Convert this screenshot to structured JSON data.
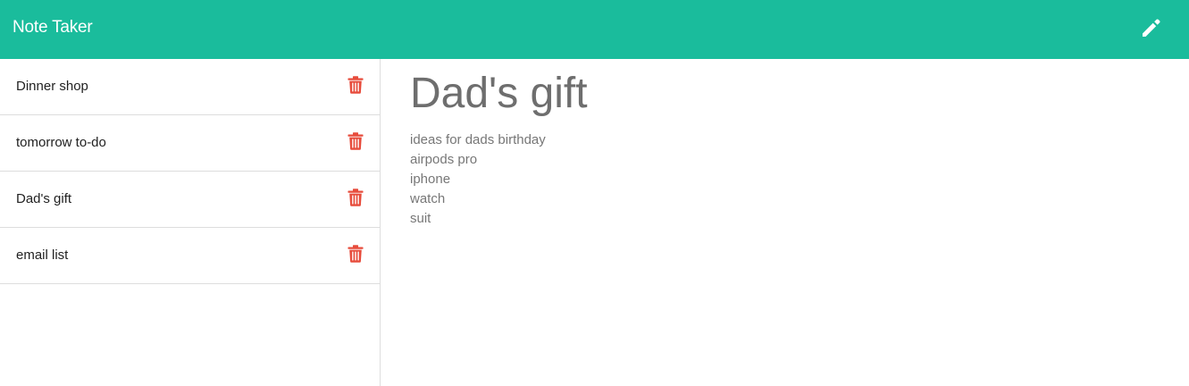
{
  "app": {
    "title": "Note Taker",
    "accent_color": "#1abc9c",
    "delete_color": "#e74c3c",
    "new_note_icon": "pencil-icon"
  },
  "sidebar": {
    "notes": [
      {
        "title": "Dinner shop"
      },
      {
        "title": "tomorrow to-do"
      },
      {
        "title": "Dad's gift"
      },
      {
        "title": "email list"
      }
    ],
    "delete_icon": "trash-icon"
  },
  "active_note": {
    "title": "Dad's gift",
    "text": "ideas for dads birthday\nairpods pro\niphone\nwatch\nsuit"
  }
}
